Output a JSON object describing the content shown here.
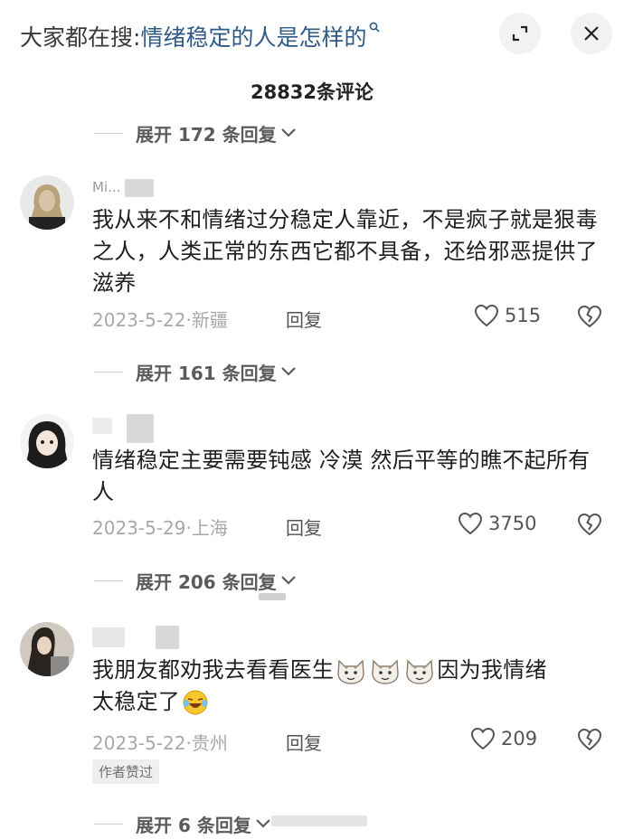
{
  "header": {
    "search_prefix": "大家都在搜:",
    "search_term": "情绪稳定的人是怎样的"
  },
  "comment_count_label": "28832条评论",
  "expanders": [
    {
      "label": "展开 172 条回复"
    },
    {
      "label": "展开 161 条回复"
    },
    {
      "label": "展开 206 条回复"
    },
    {
      "label": "展开 6 条回复"
    }
  ],
  "comments": [
    {
      "username": "Mi... ...",
      "text": "我从来不和情绪过分稳定人靠近，不是疯子就是狠毒之人，人类正常的东西它都不具备，还给邪恶提供了滋养",
      "date": "2023-5-22·新疆",
      "reply_label": "回复",
      "likes": "515"
    },
    {
      "username": "",
      "text": "情绪稳定主要需要钝感 冷漠 然后平等的瞧不起所有人",
      "date": "2023-5-29·上海",
      "reply_label": "回复",
      "likes": "3750"
    },
    {
      "username": "",
      "text_before": "我朋友都劝我去看看医生",
      "text_after": "因为我情绪",
      "text_line2": "太稳定了",
      "date": "2023-5-22·贵州",
      "reply_label": "回复",
      "likes": "209",
      "badge": "作者赞过"
    }
  ],
  "colors": {
    "search_term": "#2f5a86",
    "muted": "#a8a8a8",
    "body": "#1f1f1f"
  },
  "icons": [
    "expand-icon",
    "close-icon",
    "heart-icon",
    "broken-heart-icon",
    "chevron-down-icon",
    "cat-emoji-icon",
    "laugh-cry-emoji-icon"
  ]
}
